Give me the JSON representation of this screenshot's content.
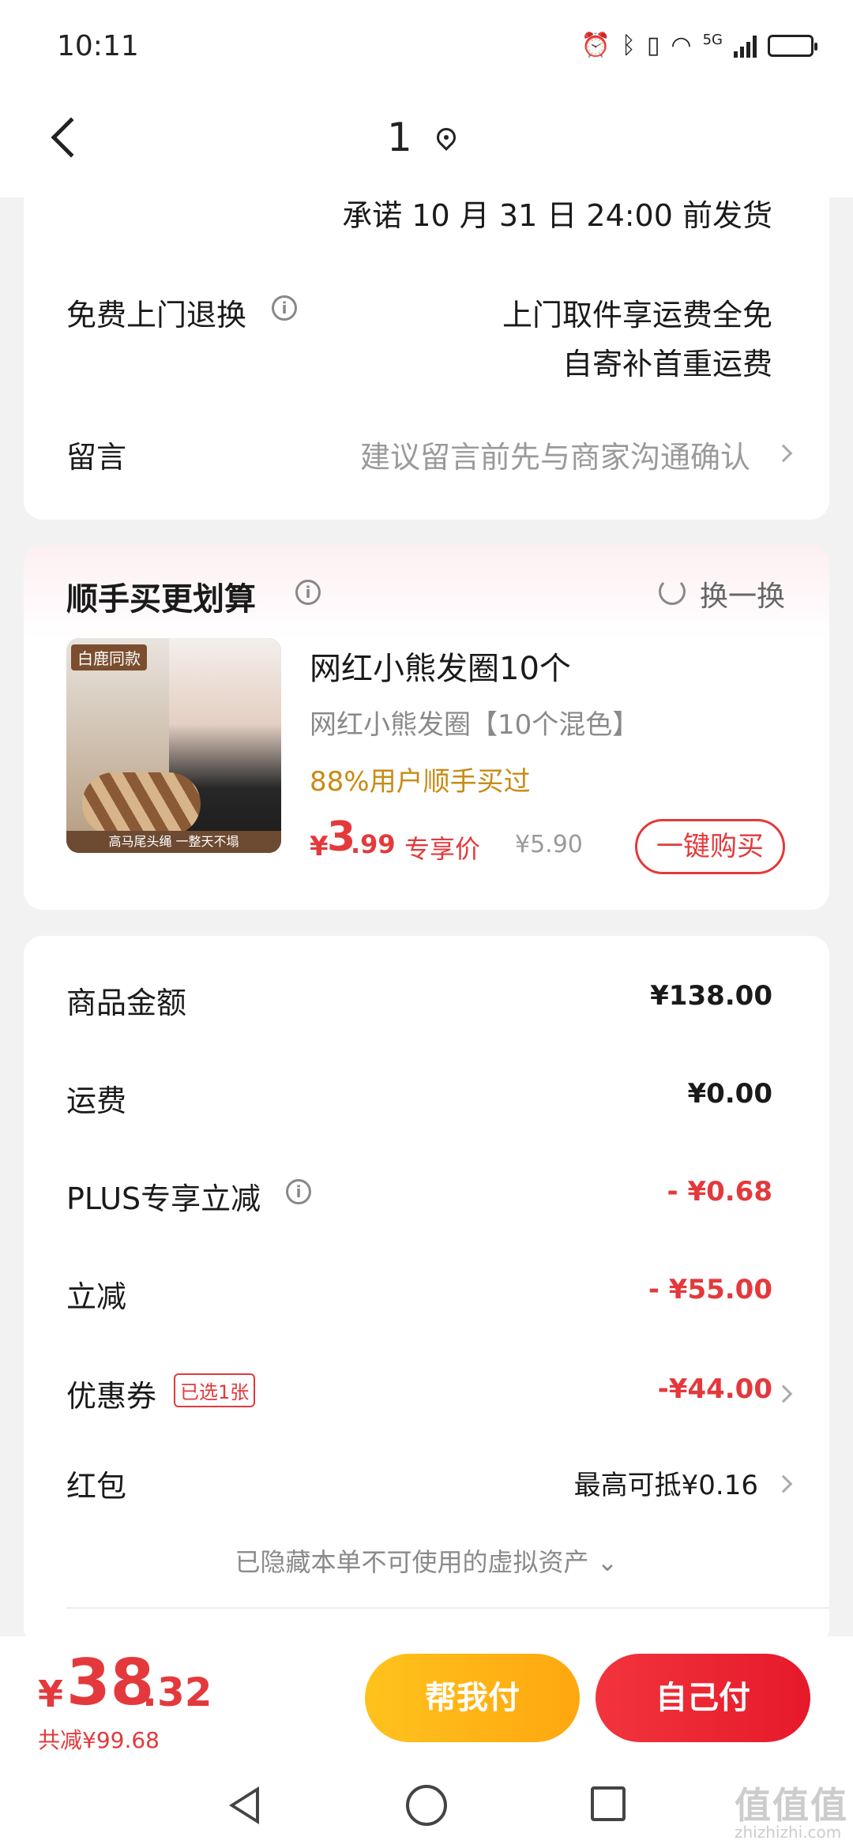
{
  "status_bar": {
    "time": "10:11",
    "network": "5G"
  },
  "header": {
    "title": "1"
  },
  "shipping": {
    "promise": "承诺 10 月 31 日 24:00 前发货"
  },
  "return_service": {
    "label": "免费上门退换",
    "line1": "上门取件享运费全免",
    "line2": "自寄补首重运费"
  },
  "message": {
    "label": "留言",
    "placeholder": "建议留言前先与商家沟通确认"
  },
  "upsell": {
    "title": "顺手买更划算",
    "refresh_label": "换一换",
    "product": {
      "image_tag": "白鹿同款",
      "image_caption": "高马尾头绳 一整天不塌",
      "name": "网红小熊发圈10个",
      "spec": "网红小熊发圈【10个混色】",
      "social_proof": "88%用户顺手买过",
      "price_symbol": "¥",
      "price_int": "3",
      "price_dec": ".99",
      "price_label": "专享价",
      "orig_price": "¥5.90",
      "buy_button": "一键购买"
    }
  },
  "summary": {
    "goods_amount": {
      "label": "商品金额",
      "value": "¥138.00"
    },
    "shipping_fee": {
      "label": "运费",
      "value": "¥0.00"
    },
    "plus_discount": {
      "label": "PLUS专享立减",
      "value": "- ¥0.68"
    },
    "instant_discount": {
      "label": "立减",
      "value": "- ¥55.00"
    },
    "coupon": {
      "label": "优惠券",
      "badge": "已选1张",
      "value": "-¥44.00"
    },
    "red_packet": {
      "label": "红包",
      "value": "最高可抵¥0.16"
    },
    "hidden_assets": "已隐藏本单不可使用的虚拟资产 ⌄"
  },
  "bottom_bar": {
    "total_symbol": "¥",
    "total_int": "38",
    "total_dec": ".32",
    "total_saved": "共减¥99.68",
    "help_pay": "帮我付",
    "self_pay": "自己付"
  },
  "watermark": {
    "glyphs": "值值值",
    "site": "zhizhizhi.com"
  },
  "colors": {
    "accent_red": "#e4393c",
    "gold": "#c98a14",
    "yellow_btn": "#ffb515",
    "red_btn": "#ee2a36"
  }
}
